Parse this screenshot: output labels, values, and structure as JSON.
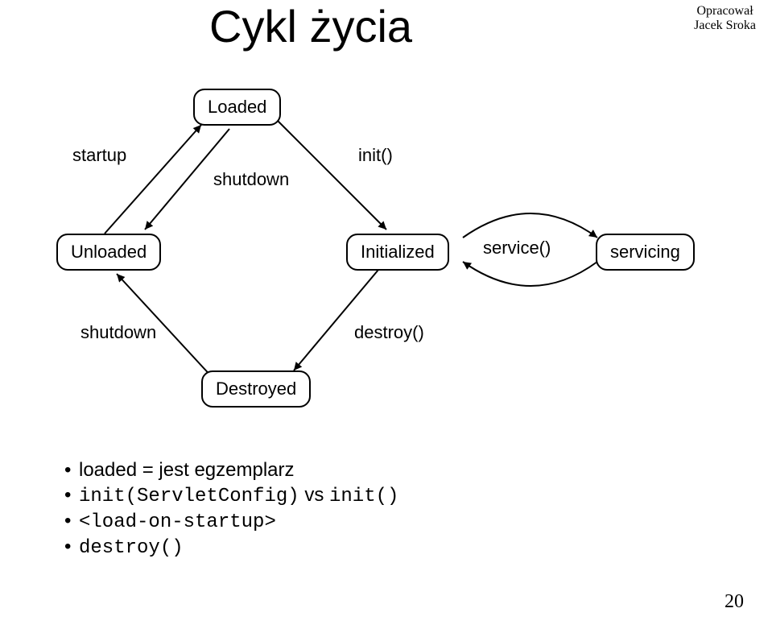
{
  "title": "Cykl życia",
  "attribution_line1": "Opracował",
  "attribution_line2": "Jacek Sroka",
  "nodes": {
    "loaded": "Loaded",
    "unloaded": "Unloaded",
    "initialized": "Initialized",
    "servicing": "servicing",
    "destroyed": "Destroyed"
  },
  "edge_labels": {
    "startup": "startup",
    "shutdown1": "shutdown",
    "init": "init()",
    "service": "service()",
    "shutdown2": "shutdown",
    "destroy": "destroy()"
  },
  "bullets": {
    "b1_prefix": "loaded = jest egzemplarz",
    "b2_code1": "init(ServletConfig)",
    "b2_mid": " vs ",
    "b2_code2": "init()",
    "b3_code": "<load-on-startup>",
    "b4_code": "destroy()"
  },
  "page_number": "20"
}
